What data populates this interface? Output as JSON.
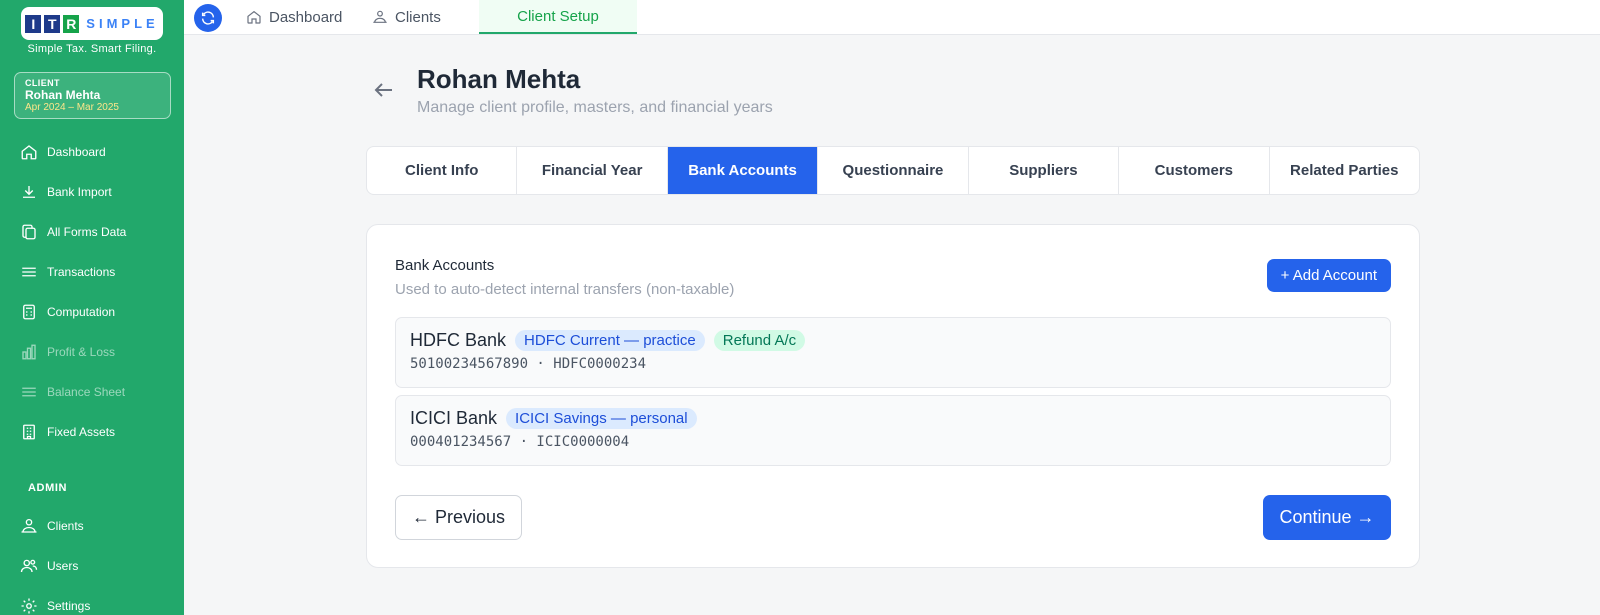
{
  "brand": {
    "logo_letters": [
      "I",
      "T",
      "R"
    ],
    "logo_word": "SIMPLE",
    "tagline": "Simple Tax. Smart Filing.",
    "colors": {
      "sidebar": "#22a86b",
      "primary": "#2563eb"
    }
  },
  "client_card": {
    "label": "CLIENT",
    "name": "Rohan Mehta",
    "range": "Apr 2024 – Mar 2025"
  },
  "sidebar": {
    "items": [
      {
        "label": "Dashboard",
        "icon": "home-icon",
        "disabled": false
      },
      {
        "label": "Bank Import",
        "icon": "download-icon",
        "disabled": false
      },
      {
        "label": "All Forms Data",
        "icon": "copy-icon",
        "disabled": false
      },
      {
        "label": "Transactions",
        "icon": "lines-icon",
        "disabled": false
      },
      {
        "label": "Computation",
        "icon": "calculator-icon",
        "disabled": false
      },
      {
        "label": "Profit & Loss",
        "icon": "bar-chart-icon",
        "disabled": true
      },
      {
        "label": "Balance Sheet",
        "icon": "lines-icon",
        "disabled": true
      },
      {
        "label": "Fixed Assets",
        "icon": "building-icon",
        "disabled": false
      }
    ],
    "admin_label": "ADMIN",
    "admin_items": [
      {
        "label": "Clients",
        "icon": "clients-icon"
      },
      {
        "label": "Users",
        "icon": "users-icon"
      },
      {
        "label": "Settings",
        "icon": "gear-icon"
      }
    ]
  },
  "topbar": {
    "tabs": [
      {
        "label": "Dashboard",
        "icon": "home-icon"
      },
      {
        "label": "Clients",
        "icon": "clients-icon"
      },
      {
        "label": "Client Setup",
        "active": true
      }
    ]
  },
  "header": {
    "title": "Rohan Mehta",
    "subtitle": "Manage client profile, masters, and financial years"
  },
  "tabs": [
    {
      "label": "Client Info"
    },
    {
      "label": "Financial Year"
    },
    {
      "label": "Bank Accounts",
      "active": true
    },
    {
      "label": "Questionnaire"
    },
    {
      "label": "Suppliers"
    },
    {
      "label": "Customers"
    },
    {
      "label": "Related Parties"
    }
  ],
  "panel": {
    "title": "Bank Accounts",
    "subtitle": "Used to auto-detect internal transfers (non-taxable)",
    "add_label": "+ Add Account",
    "accounts": [
      {
        "bank": "HDFC Bank",
        "badges": [
          {
            "text": "HDFC Current — practice",
            "color": "blue"
          },
          {
            "text": "Refund A/c",
            "color": "green"
          }
        ],
        "meta": "50100234567890 · HDFC0000234"
      },
      {
        "bank": "ICICI Bank",
        "badges": [
          {
            "text": "ICICI Savings — personal",
            "color": "blue"
          }
        ],
        "meta": "000401234567 · ICIC0000004"
      }
    ],
    "prev_label": "← Previous",
    "continue_label": "Continue →"
  }
}
